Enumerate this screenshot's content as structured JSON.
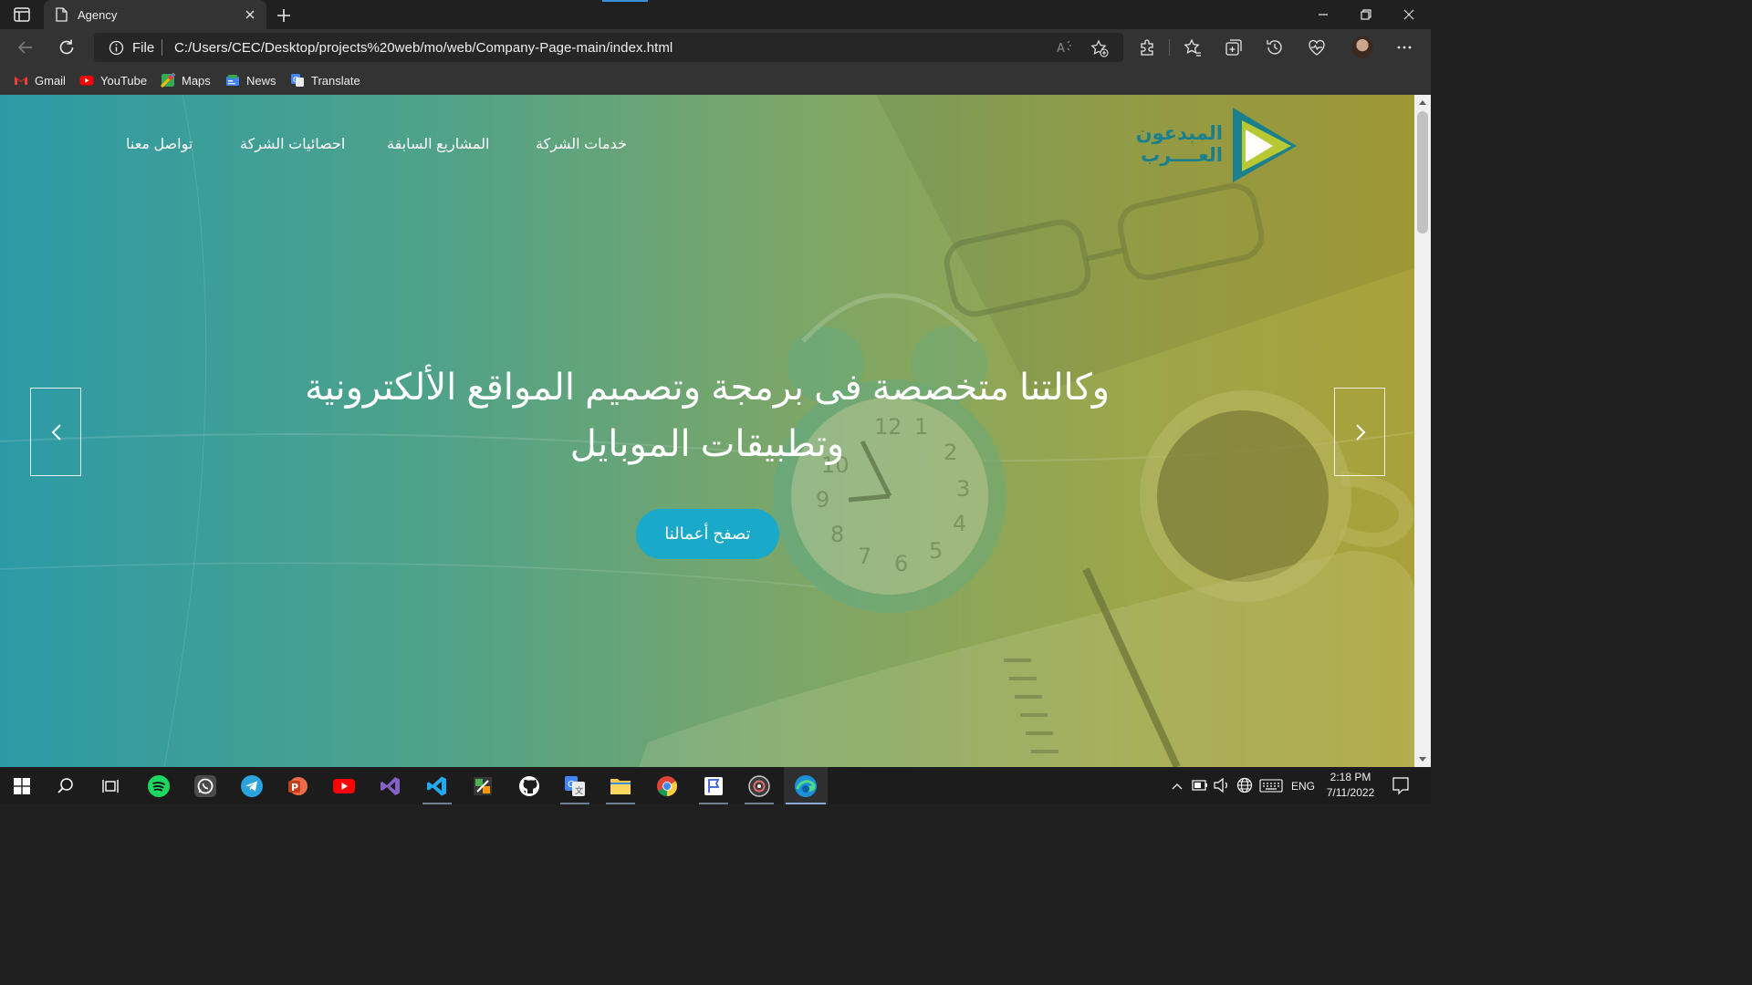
{
  "browser": {
    "tab": {
      "title": "Agency"
    },
    "address": {
      "scheme_label": "File",
      "url": "C:/Users/CEC/Desktop/projects%20web/mo/web/Company-Page-main/index.html"
    },
    "bookmarks": [
      {
        "label": "Gmail",
        "icon": "gmail-icon",
        "color": "#ea4335"
      },
      {
        "label": "YouTube",
        "icon": "youtube-icon",
        "color": "#ff0000"
      },
      {
        "label": "Maps",
        "icon": "maps-icon",
        "color": "#34a853"
      },
      {
        "label": "News",
        "icon": "news-icon",
        "color": "#4285f4"
      },
      {
        "label": "Translate",
        "icon": "translate-icon",
        "color": "#4285f4"
      }
    ]
  },
  "site": {
    "logo": {
      "line1": "المبدعون",
      "line2": "العــــرب"
    },
    "nav": [
      {
        "label": "خدمات الشركة"
      },
      {
        "label": "المشاريع السابقة"
      },
      {
        "label": "احصائيات الشركة"
      },
      {
        "label": "تواصل معنا"
      }
    ],
    "hero": {
      "headline_line1": "وكالتنا متخصصة فى برمجة وتصميم المواقع الألكترونية",
      "headline_line2": "وتطبيقات الموبايل",
      "cta_label": "تصفح أعمالنا"
    },
    "colors": {
      "cta": "#1aa9c9",
      "logo_teal": "#1b7f8c",
      "gradient_left": "#2c9aa6",
      "gradient_right": "#aaa13a"
    }
  },
  "taskbar": {
    "apps": [
      "start-icon",
      "search-icon",
      "task-view-icon",
      "spotify-icon",
      "whatsapp-icon",
      "telegram-icon",
      "powerpoint-icon",
      "youtube-icon",
      "visual-studio-icon",
      "vscode-icon",
      "sublime-icon",
      "github-icon",
      "google-translate-icon",
      "file-explorer-icon",
      "chrome-icon",
      "snip-icon",
      "media-icon",
      "edge-icon"
    ],
    "tray": {
      "language": "ENG",
      "time": "2:18 PM",
      "date": "7/11/2022"
    }
  }
}
